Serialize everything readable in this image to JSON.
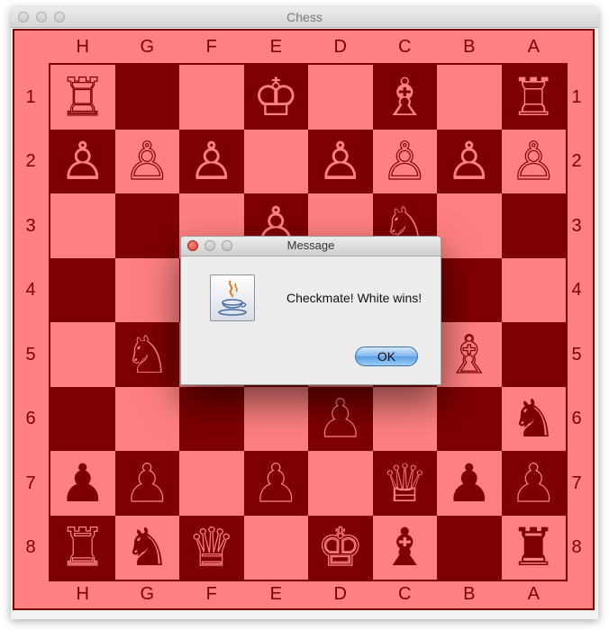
{
  "window": {
    "title": "Chess"
  },
  "board": {
    "files": [
      "H",
      "G",
      "F",
      "E",
      "D",
      "C",
      "B",
      "A"
    ],
    "ranks": [
      "1",
      "2",
      "3",
      "4",
      "5",
      "6",
      "7",
      "8"
    ],
    "light_color": "#ff8080",
    "dark_color": "#7d0000",
    "pieces": [
      {
        "square": "H1",
        "piece": "rook",
        "color": "white",
        "glyph": "♖"
      },
      {
        "square": "E1",
        "piece": "king",
        "color": "white",
        "glyph": "♔"
      },
      {
        "square": "C1",
        "piece": "bishop",
        "color": "white",
        "glyph": "♗"
      },
      {
        "square": "A1",
        "piece": "rook",
        "color": "white",
        "glyph": "♖"
      },
      {
        "square": "H2",
        "piece": "pawn",
        "color": "white",
        "glyph": "♙"
      },
      {
        "square": "G2",
        "piece": "pawn",
        "color": "white",
        "glyph": "♙"
      },
      {
        "square": "F2",
        "piece": "pawn",
        "color": "white",
        "glyph": "♙"
      },
      {
        "square": "D2",
        "piece": "pawn",
        "color": "white",
        "glyph": "♙"
      },
      {
        "square": "C2",
        "piece": "pawn",
        "color": "white",
        "glyph": "♙"
      },
      {
        "square": "B2",
        "piece": "pawn",
        "color": "white",
        "glyph": "♙"
      },
      {
        "square": "A2",
        "piece": "pawn",
        "color": "white",
        "glyph": "♙"
      },
      {
        "square": "E3",
        "piece": "pawn",
        "color": "white",
        "glyph": "♙"
      },
      {
        "square": "C3",
        "piece": "knight",
        "color": "white",
        "glyph": "♘"
      },
      {
        "square": "G5",
        "piece": "knight",
        "color": "white",
        "glyph": "♘"
      },
      {
        "square": "B5",
        "piece": "bishop",
        "color": "white",
        "glyph": "♗"
      },
      {
        "square": "D6",
        "piece": "pawn",
        "color": "black",
        "glyph": "♟"
      },
      {
        "square": "A6",
        "piece": "knight",
        "color": "black",
        "glyph": "♞"
      },
      {
        "square": "H7",
        "piece": "pawn",
        "color": "black",
        "glyph": "♟"
      },
      {
        "square": "G7",
        "piece": "pawn",
        "color": "black",
        "glyph": "♟"
      },
      {
        "square": "E7",
        "piece": "pawn",
        "color": "black",
        "glyph": "♟"
      },
      {
        "square": "C7",
        "piece": "queen",
        "color": "white",
        "glyph": "♕"
      },
      {
        "square": "B7",
        "piece": "pawn",
        "color": "black",
        "glyph": "♟"
      },
      {
        "square": "A7",
        "piece": "pawn",
        "color": "black",
        "glyph": "♟"
      },
      {
        "square": "H8",
        "piece": "rook",
        "color": "black",
        "glyph": "♜"
      },
      {
        "square": "G8",
        "piece": "knight",
        "color": "black",
        "glyph": "♞"
      },
      {
        "square": "F8",
        "piece": "queen",
        "color": "black",
        "glyph": "♛"
      },
      {
        "square": "D8",
        "piece": "king",
        "color": "black",
        "glyph": "♚"
      },
      {
        "square": "C8",
        "piece": "bishop",
        "color": "black",
        "glyph": "♝"
      },
      {
        "square": "A8",
        "piece": "rook",
        "color": "black",
        "glyph": "♜"
      }
    ]
  },
  "dialog": {
    "title": "Message",
    "icon": "java-coffee-icon",
    "message": "Checkmate! White wins!",
    "ok_label": "OK"
  }
}
